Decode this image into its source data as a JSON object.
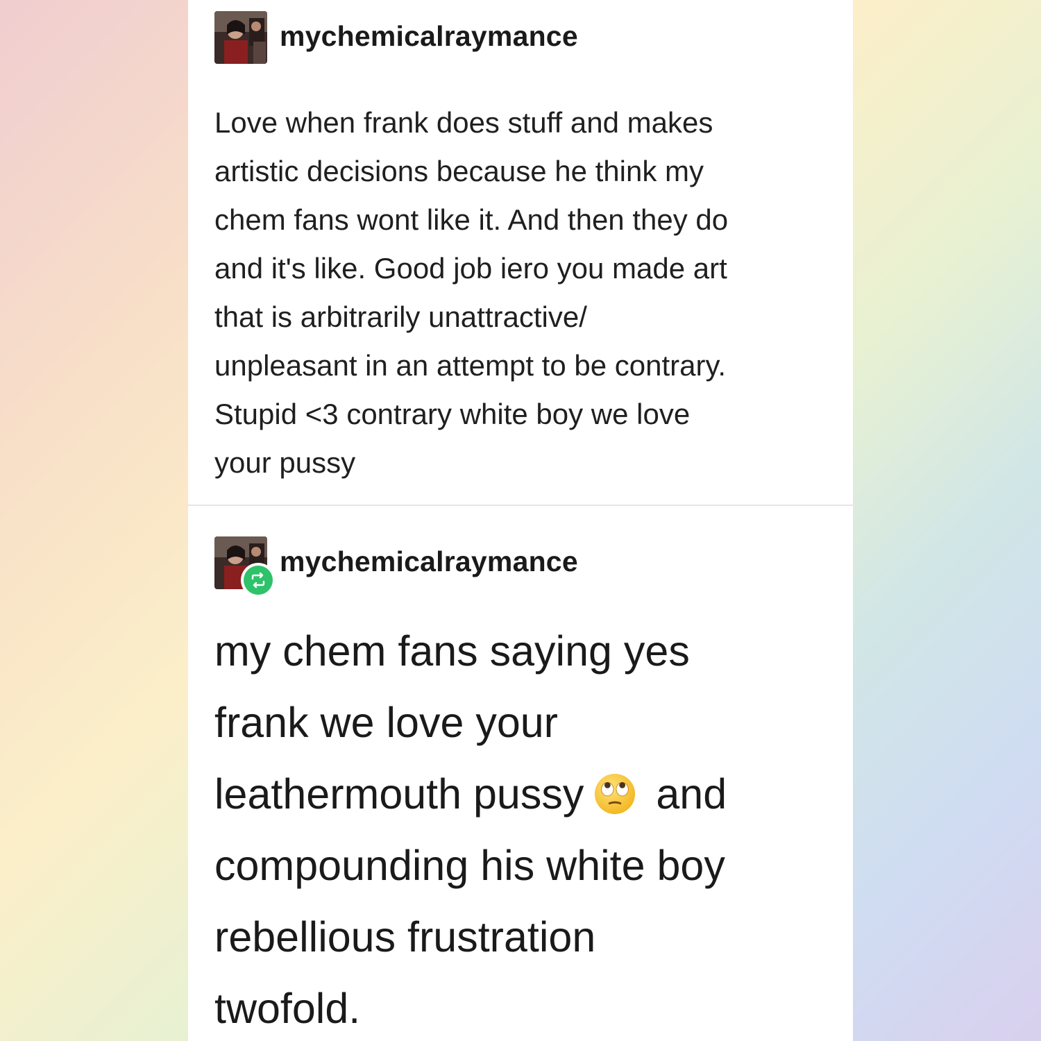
{
  "posts": [
    {
      "username": "mychemicalraymance",
      "body_lines": [
        "Love when frank does stuff and makes",
        "artistic decisions because he think my",
        "chem fans wont like it. And then they do",
        "and it's like. Good job iero you made art",
        "that is arbitrarily unattractive/",
        "unpleasant in an attempt to be contrary.",
        "Stupid <3 contrary white boy we love",
        "your pussy"
      ]
    },
    {
      "username": "mychemicalraymance",
      "reblog_icon": "reblog-icon",
      "body_lines": [
        "my chem fans saying yes",
        "frank we love your",
        "leathermouth pussy",
        "and",
        "compounding his white boy",
        "rebellious frustration",
        "twofold."
      ],
      "emoji": "face-with-rolling-eyes-emoji"
    }
  ],
  "colors": {
    "card": "#ffffff",
    "text": "#1a1a1a",
    "reblog_badge": "#2ec26a",
    "divider": "#e6e6e6"
  }
}
